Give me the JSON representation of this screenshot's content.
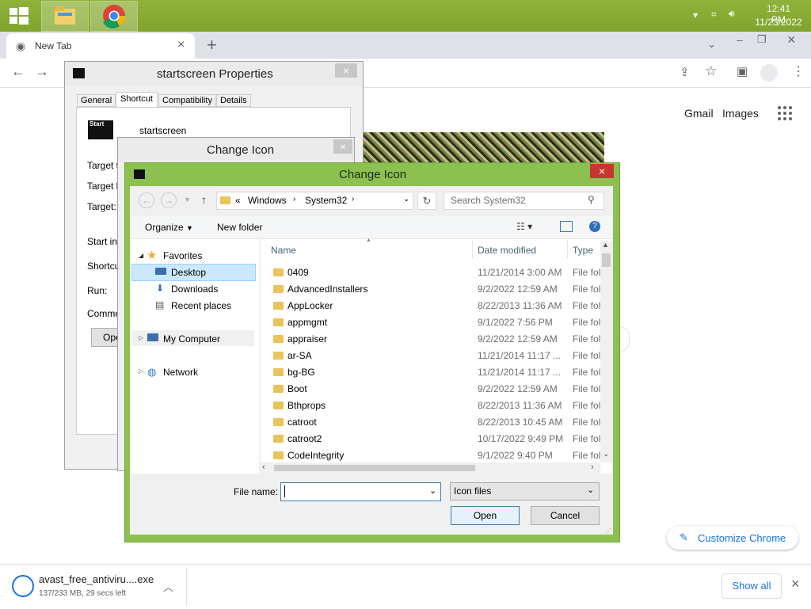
{
  "taskbar": {
    "time": "12:41 PM",
    "date": "11/23/2022",
    "icons": [
      "windows-start-icon",
      "file-explorer-icon",
      "chrome-icon"
    ]
  },
  "chrome": {
    "tab_title": "New Tab",
    "google_links": {
      "gmail": "Gmail",
      "images": "Images"
    },
    "customize_label": "Customize Chrome"
  },
  "download_bar": {
    "filename": "avast_free_antiviru....exe",
    "status": "137/233 MB, 29 secs left",
    "show_all": "Show all"
  },
  "properties_dialog": {
    "title": "startscreen Properties",
    "tabs": [
      "General",
      "Shortcut",
      "Compatibility",
      "Details"
    ],
    "active_tab": "Shortcut",
    "icon_label": "Start",
    "name": "startscreen",
    "fields": [
      "Target t",
      "Target lo",
      "Target:",
      "Start in:",
      "Shortcut",
      "Run:",
      "Commen"
    ],
    "open_button": "Ope"
  },
  "change_icon_back": {
    "title": "Change Icon"
  },
  "file_dialog": {
    "title": "Change Icon",
    "address": {
      "prefix": "«",
      "parts": [
        "Windows",
        "System32"
      ]
    },
    "search_placeholder": "Search System32",
    "toolbar": {
      "organize": "Organize",
      "new_folder": "New folder"
    },
    "nav": {
      "favorites": "Favorites",
      "desktop": "Desktop",
      "downloads": "Downloads",
      "recent": "Recent places",
      "my_computer": "My Computer",
      "network": "Network"
    },
    "columns": {
      "name": "Name",
      "date": "Date modified",
      "type": "Type"
    },
    "files": [
      {
        "name": "0409",
        "date": "11/21/2014 3:00 AM",
        "type": "File fol"
      },
      {
        "name": "AdvancedInstallers",
        "date": "9/2/2022 12:59 AM",
        "type": "File fol"
      },
      {
        "name": "AppLocker",
        "date": "8/22/2013 11:36 AM",
        "type": "File fol"
      },
      {
        "name": "appmgmt",
        "date": "9/1/2022 7:56 PM",
        "type": "File fol"
      },
      {
        "name": "appraiser",
        "date": "9/2/2022 12:59 AM",
        "type": "File fol"
      },
      {
        "name": "ar-SA",
        "date": "11/21/2014 11:17 ...",
        "type": "File fol"
      },
      {
        "name": "bg-BG",
        "date": "11/21/2014 11:17 ...",
        "type": "File fol"
      },
      {
        "name": "Boot",
        "date": "9/2/2022 12:59 AM",
        "type": "File fol"
      },
      {
        "name": "Bthprops",
        "date": "8/22/2013 11:36 AM",
        "type": "File fol"
      },
      {
        "name": "catroot",
        "date": "8/22/2013 10:45 AM",
        "type": "File fol"
      },
      {
        "name": "catroot2",
        "date": "10/17/2022 9:49 PM",
        "type": "File fol"
      },
      {
        "name": "CodeIntegrity",
        "date": "9/1/2022 9:40 PM",
        "type": "File fol"
      }
    ],
    "filename_label": "File name:",
    "filename_value": "",
    "filetype": "Icon files",
    "open": "Open",
    "cancel": "Cancel"
  }
}
